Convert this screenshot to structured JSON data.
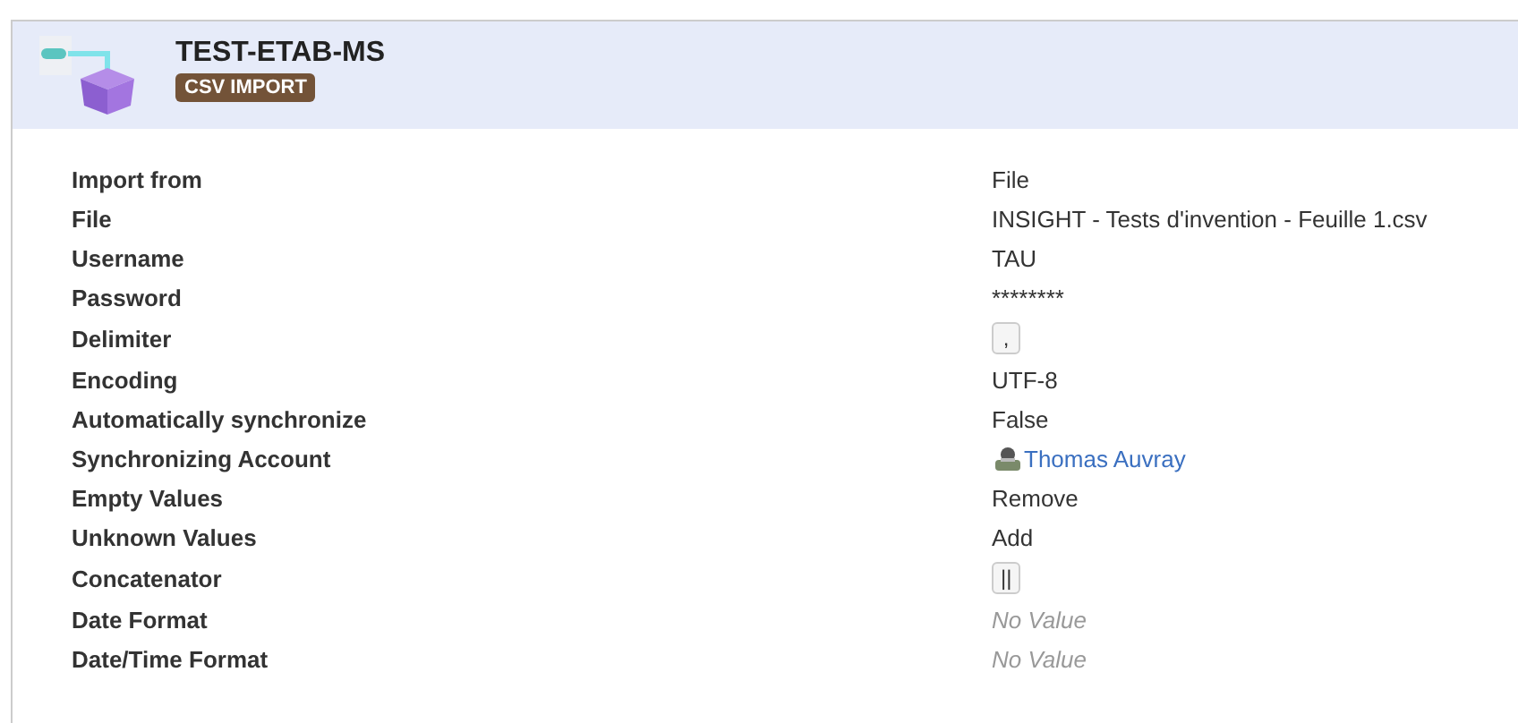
{
  "header": {
    "title": "TEST-ETAB-MS",
    "badge": "CSV IMPORT"
  },
  "fields": [
    {
      "label": "Import from",
      "kind": "text",
      "value": "File"
    },
    {
      "label": "File",
      "kind": "text",
      "value": "INSIGHT - Tests d'invention - Feuille 1.csv"
    },
    {
      "label": "Username",
      "kind": "text",
      "value": "TAU"
    },
    {
      "label": "Password",
      "kind": "text",
      "value": "********"
    },
    {
      "label": "Delimiter",
      "kind": "code",
      "value": ","
    },
    {
      "label": "Encoding",
      "kind": "text",
      "value": "UTF-8"
    },
    {
      "label": "Automatically synchronize",
      "kind": "text",
      "value": "False"
    },
    {
      "label": "Synchronizing Account",
      "kind": "link",
      "value": "Thomas Auvray"
    },
    {
      "label": "Empty Values",
      "kind": "text",
      "value": "Remove"
    },
    {
      "label": "Unknown Values",
      "kind": "text",
      "value": "Add"
    },
    {
      "label": "Concatenator",
      "kind": "code",
      "value": "||"
    },
    {
      "label": "Date Format",
      "kind": "empty",
      "value": "No Value"
    },
    {
      "label": "Date/Time Format",
      "kind": "empty",
      "value": "No Value"
    }
  ]
}
